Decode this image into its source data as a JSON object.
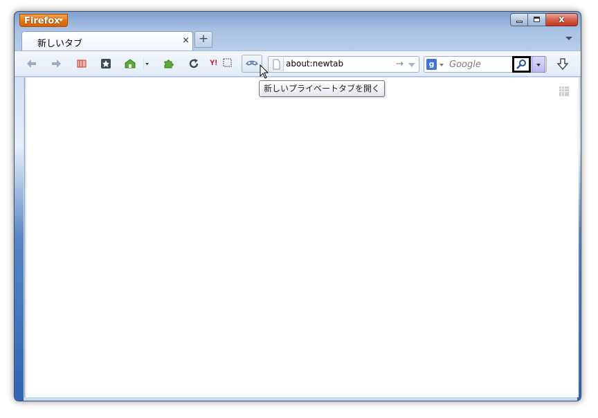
{
  "app": {
    "menu_button_label": "Firefox"
  },
  "window_controls": {
    "close_label": "x"
  },
  "tabs": [
    {
      "title": "新しいタブ",
      "close": "×"
    }
  ],
  "new_tab_label": "+",
  "navbar": {
    "url": "about:newtab",
    "go_arrow": "→",
    "search": {
      "engine_icon": "g",
      "placeholder": "Google"
    }
  },
  "tooltip": {
    "text": "新しいプライベートタブを開く"
  },
  "icons": {
    "back": "back-arrow-icon",
    "forward": "forward-arrow-icon",
    "bookmarks": "bookmarks-icon",
    "bookmark_star": "star-icon",
    "home": "home-icon",
    "addons": "puzzle-icon",
    "reload": "reload-icon",
    "yahoo": "yahoo-icon",
    "private": "private-browsing-icon",
    "download": "download-icon"
  },
  "colors": {
    "firefox_orange": "#e2730f",
    "frame_blue": "#2f64b3",
    "search_dropdown": "#bcb7f0"
  }
}
